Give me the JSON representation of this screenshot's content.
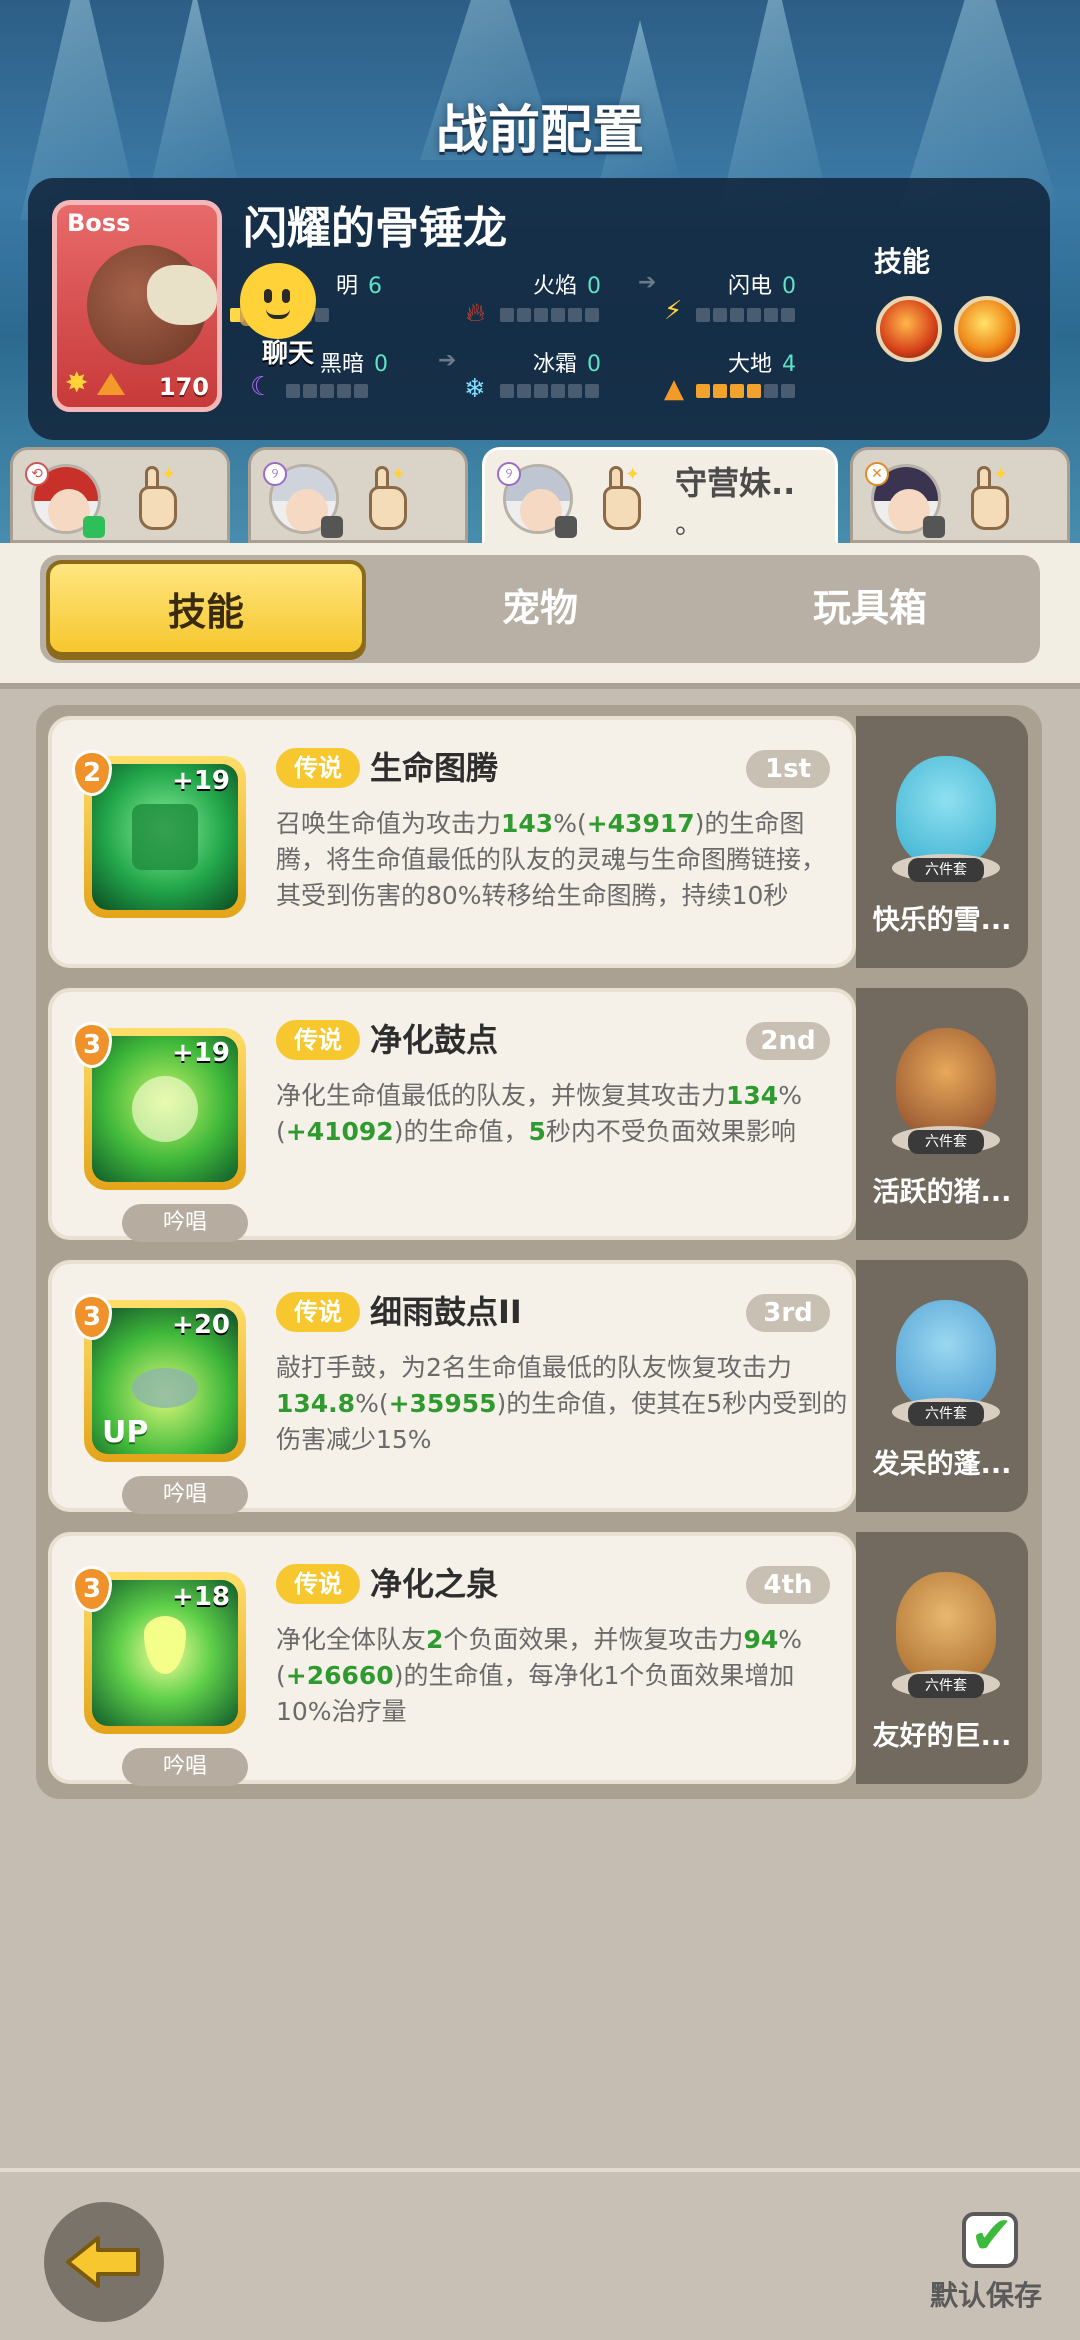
{
  "header": {
    "title": "战前配置"
  },
  "boss": {
    "tag": "Boss",
    "name": "闪耀的骨锤龙",
    "level": "170",
    "elements": [
      {
        "label": "明",
        "value": "6"
      },
      {
        "label": "火焰",
        "value": "0"
      },
      {
        "label": "闪电",
        "value": "0"
      },
      {
        "label": "黑暗",
        "value": "0"
      },
      {
        "label": "冰霜",
        "value": "0"
      },
      {
        "label": "大地",
        "value": "4"
      }
    ],
    "skills_label": "技能"
  },
  "chat": {
    "label": "聊天"
  },
  "heroes": [
    {
      "name": ""
    },
    {
      "name": ""
    },
    {
      "name": "守营妹..",
      "name2": "。",
      "active": true
    },
    {
      "name": ""
    }
  ],
  "category_tabs": [
    {
      "label": "技能",
      "active": true
    },
    {
      "label": "宠物"
    },
    {
      "label": "玩具箱"
    }
  ],
  "skills": [
    {
      "level": "2",
      "bonus": "+19",
      "rarity": "传说",
      "name": "生命图腾",
      "rank": "1st",
      "chant": "",
      "desc": [
        {
          "t": "召唤生命值为攻击力"
        },
        {
          "t": "143",
          "g": true
        },
        {
          "t": "%("
        },
        {
          "t": "+43917",
          "g": true
        },
        {
          "t": ")的生命图腾，将生命值最低的队友的灵魂与生命图腾链接，其受到伤害的80%转移给生命图腾，持续10秒"
        }
      ],
      "pet": "快乐的雪..."
    },
    {
      "level": "3",
      "bonus": "+19",
      "rarity": "传说",
      "name": "净化鼓点",
      "rank": "2nd",
      "chant": "吟唱",
      "desc": [
        {
          "t": "净化生命值最低的队友，并恢复其攻击力"
        },
        {
          "t": "134",
          "g": true
        },
        {
          "t": "%("
        },
        {
          "t": "+41092",
          "g": true
        },
        {
          "t": ")的生命值，"
        },
        {
          "t": "5",
          "g": true
        },
        {
          "t": "秒内不受负面效果影响"
        }
      ],
      "pet": "活跃的猪..."
    },
    {
      "level": "3",
      "bonus": "+20",
      "rarity": "传说",
      "name": "细雨鼓点II",
      "rank": "3rd",
      "chant": "吟唱",
      "up": "UP",
      "desc": [
        {
          "t": "敲打手鼓，为2名生命值最低的队友恢复攻击力"
        },
        {
          "t": "134.8",
          "g": true
        },
        {
          "t": "%("
        },
        {
          "t": "+35955",
          "g": true
        },
        {
          "t": ")的生命值，使其在5秒内受到的伤害减少15%"
        }
      ],
      "pet": "发呆的蓬..."
    },
    {
      "level": "3",
      "bonus": "+18",
      "rarity": "传说",
      "name": "净化之泉",
      "rank": "4th",
      "chant": "吟唱",
      "desc": [
        {
          "t": "净化全体队友"
        },
        {
          "t": "2",
          "g": true
        },
        {
          "t": "个负面效果，并恢复攻击力"
        },
        {
          "t": "94",
          "g": true
        },
        {
          "t": "%("
        },
        {
          "t": "+26660",
          "g": true
        },
        {
          "t": ")的生命值，每净化1个负面效果增加10%治疗量"
        }
      ],
      "pet": "友好的巨..."
    }
  ],
  "pet_set_label": "六件套",
  "footer": {
    "save_label": "默认保存"
  }
}
